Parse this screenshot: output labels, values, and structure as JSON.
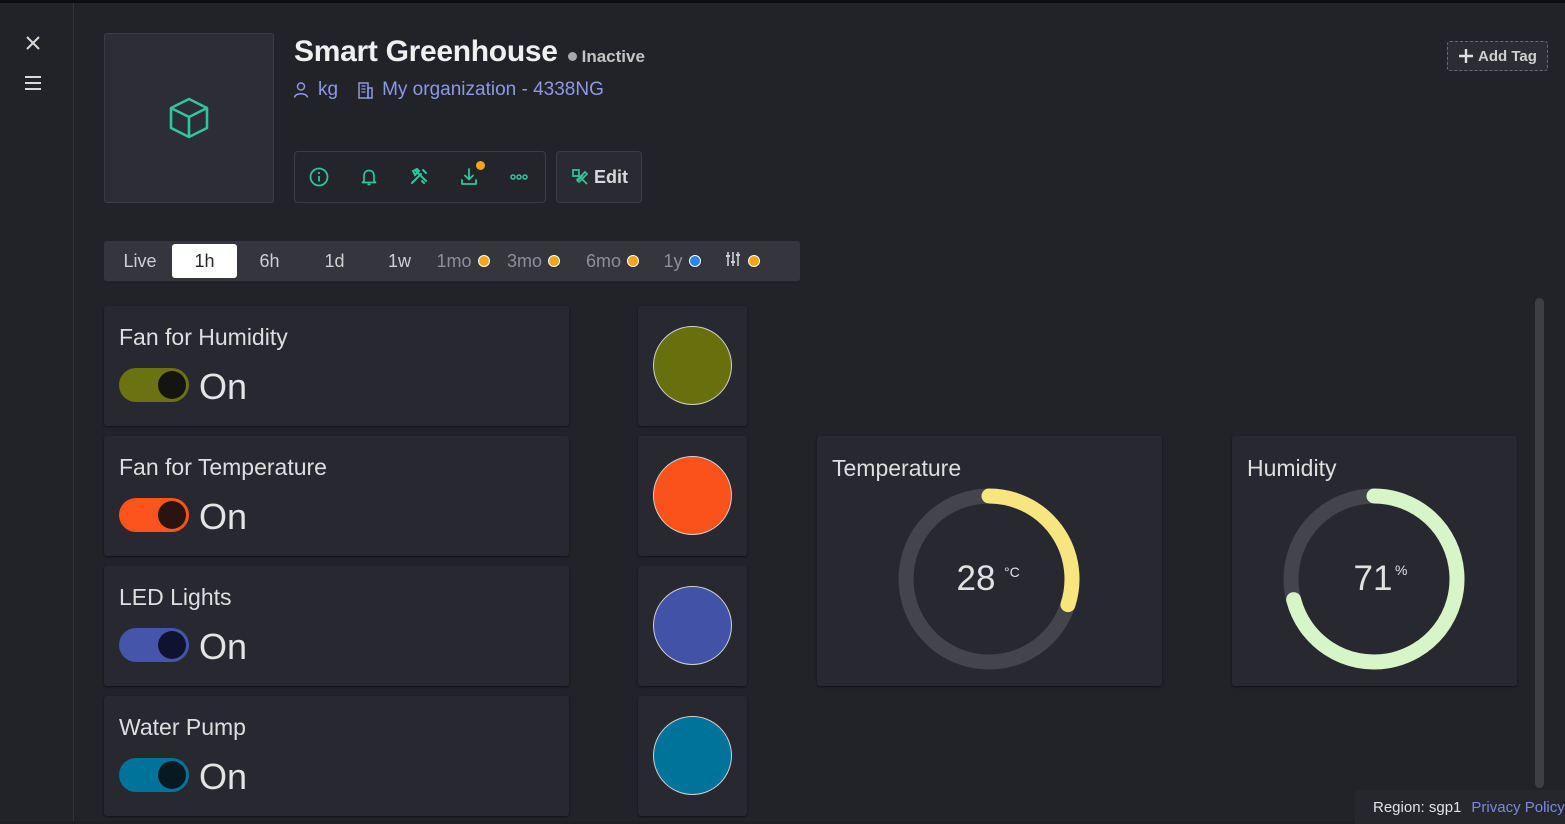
{
  "sidebar": {
    "close_icon": "close-icon",
    "menu_icon": "hamburger-menu-icon"
  },
  "device": {
    "name": "Smart Greenhouse",
    "status": "Inactive",
    "owner": "kg",
    "organization": "My organization - 4338NG",
    "icon": "cube-icon",
    "icon_color": "#2fc59d"
  },
  "toolbar": {
    "tools": [
      "info-icon",
      "bell-icon",
      "tools-icon",
      "download-icon",
      "more-icon"
    ],
    "edit_label": "Edit"
  },
  "add_tag_label": "Add Tag",
  "time_ranges": {
    "selected": "1h",
    "items": [
      {
        "label": "Live",
        "locked": false
      },
      {
        "label": "1h",
        "locked": false
      },
      {
        "label": "6h",
        "locked": false
      },
      {
        "label": "1d",
        "locked": false
      },
      {
        "label": "1w",
        "locked": false
      },
      {
        "label": "1mo",
        "locked": true,
        "dot_color": "#f6a51a"
      },
      {
        "label": "3mo",
        "locked": true,
        "dot_color": "#f6a51a"
      },
      {
        "label": "6mo",
        "locked": true,
        "dot_color": "#f6a51a"
      },
      {
        "label": "1y",
        "locked": true,
        "dot_color": "#2b84f0"
      },
      {
        "label": "",
        "icon": "sliders-icon",
        "locked": true,
        "dot_color": "#f6a51a"
      }
    ]
  },
  "switches": [
    {
      "label": "Fan for Humidity",
      "state": "On",
      "color": "#6b7212",
      "knob": "#141510",
      "led_color": "#68700e"
    },
    {
      "label": "Fan for Temperature",
      "state": "On",
      "color": "#fd531d",
      "knob": "#2a1410",
      "led_color": "#fb521c"
    },
    {
      "label": "LED Lights",
      "state": "On",
      "color": "#4455aa",
      "knob": "#0f1330",
      "led_color": "#4253a7"
    },
    {
      "label": "Water Pump",
      "state": "On",
      "color": "#00739b",
      "knob": "#071a22",
      "led_color": "#00739b"
    }
  ],
  "gauges": {
    "temperature": {
      "title": "Temperature",
      "value": "28",
      "unit": "°C",
      "fraction": 0.3,
      "color": "#f7e67f"
    },
    "humidity": {
      "title": "Humidity",
      "value": "71",
      "unit": "%",
      "fraction": 0.71,
      "color": "#d8f4c9"
    }
  },
  "footer": {
    "region": "Region: sgp1",
    "privacy": "Privacy Policy"
  }
}
